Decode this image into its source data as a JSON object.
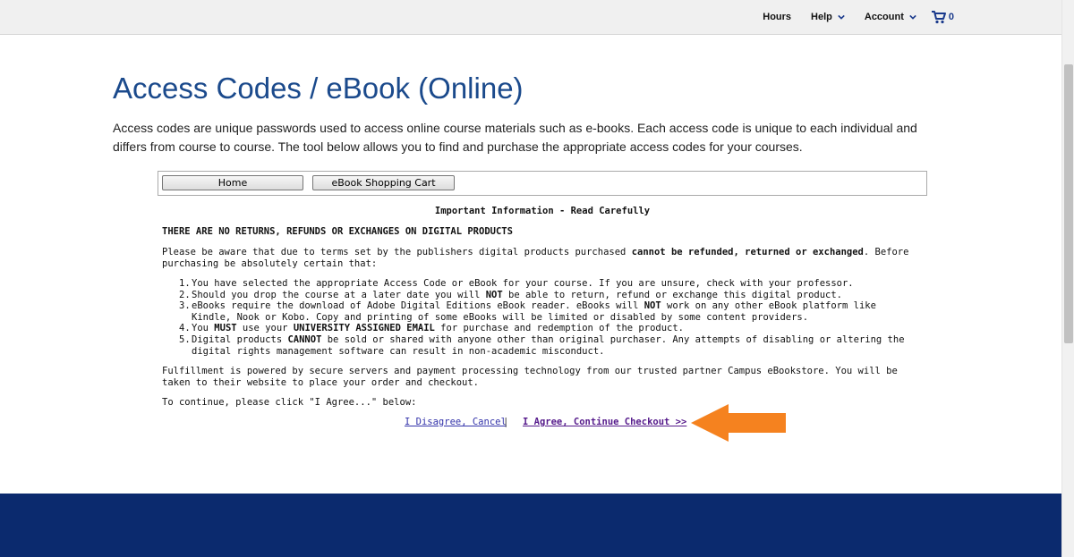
{
  "nav": {
    "hours": "Hours",
    "help": "Help",
    "account": "Account",
    "cart_count": "0"
  },
  "page": {
    "title": "Access Codes / eBook (Online)",
    "intro": "Access codes are unique passwords used to access online course materials such as e-books. Each access code is unique to each individual and differs from course to course. The tool below allows you to find and purchase the appropriate access codes for your courses."
  },
  "toolbar": {
    "home_label": "Home",
    "cart_label": "eBook Shopping Cart"
  },
  "info": {
    "heading": "Important Information - Read Carefully",
    "no_returns": "THERE ARE NO RETURNS, REFUNDS OR EXCHANGES ON DIGITAL PRODUCTS",
    "para1_a": "Please be aware that due to terms set by the publishers digital products purchased ",
    "para1_b": "cannot be refunded, returned or exchanged",
    "para1_c": ". Before purchasing be absolutely certain that:",
    "items": [
      {
        "n": "1.",
        "text": "You have selected the appropriate Access Code or eBook for your course. If you are unsure, check with your professor."
      },
      {
        "n": "2.",
        "a": "Should you drop the course at a later date you will ",
        "b": "NOT",
        "c": " be able to return, refund or exchange this digital product."
      },
      {
        "n": "3.",
        "a": "eBooks require the download of Adobe Digital Editions eBook reader. eBooks will ",
        "b": "NOT",
        "c": " work on any other eBook platform like Kindle, Nook or Kobo. Copy and printing of some eBooks will be limited or disabled by some content providers."
      },
      {
        "n": "4.",
        "a": "You ",
        "b": "MUST",
        "c": " use your ",
        "d": "UNIVERSITY ASSIGNED EMAIL",
        "e": " for purchase and redemption of the product."
      },
      {
        "n": "5.",
        "a": "Digital products ",
        "b": "CANNOT",
        "c": " be sold or shared with anyone other than original purchaser. Any attempts of disabling or altering the digital rights management software can result in non-academic misconduct."
      }
    ],
    "para2": "Fulfillment is powered by secure servers and payment processing technology from our trusted partner Campus eBookstore. You will be taken to their website to place your order and checkout.",
    "para3": "To continue, please click \"I Agree...\" below:"
  },
  "actions": {
    "disagree": "I Disagree, Cancel",
    "separator": "|",
    "agree": "I Agree, Continue Checkout >>"
  },
  "colors": {
    "title": "#1b4a8c",
    "footer": "#0b2a6e",
    "arrow": "#f5821f"
  }
}
